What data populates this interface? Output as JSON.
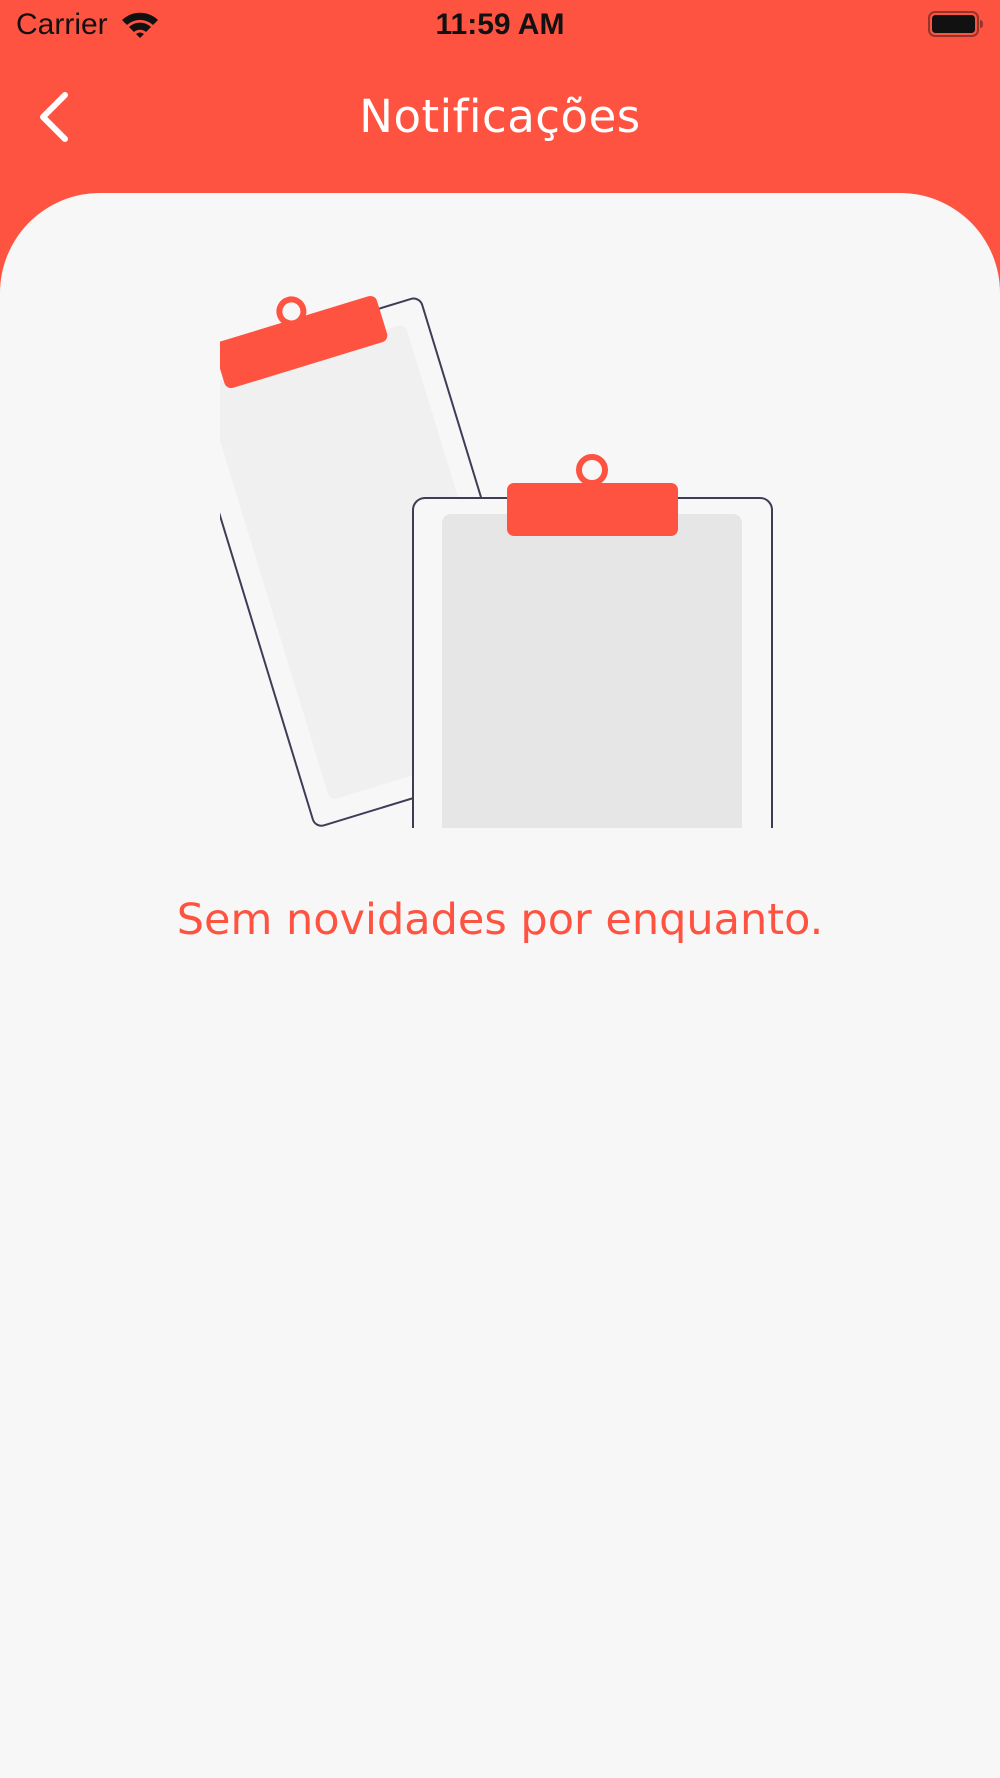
{
  "status_bar": {
    "carrier": "Carrier",
    "time": "11:59 AM",
    "wifi_icon": "wifi-icon",
    "battery_icon": "battery-icon"
  },
  "header": {
    "title": "Notificações",
    "back_icon": "chevron-left-icon"
  },
  "empty_state": {
    "illustration": "empty-clipboards-illustration",
    "message": "Sem novidades por enquanto."
  },
  "colors": {
    "accent": "#FF5341",
    "background": "#F7F7F7",
    "text_dark": "#111111",
    "outline": "#3F3D56",
    "paper": "#E6E6E6"
  }
}
